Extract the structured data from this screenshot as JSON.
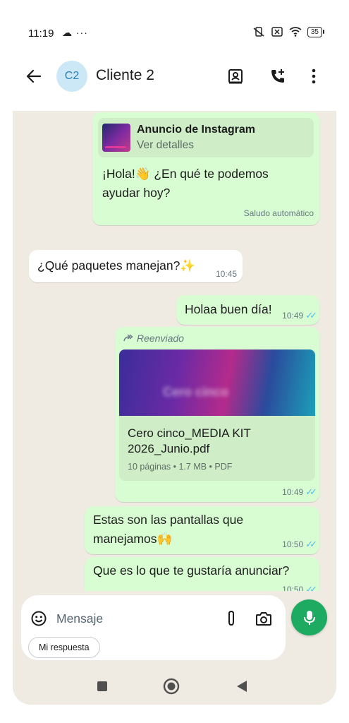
{
  "status_bar": {
    "time": "11:19",
    "left_icons": "☁ ···",
    "battery": "35"
  },
  "header": {
    "avatar_initials": "C2",
    "contact_name": "Cliente 2"
  },
  "messages": {
    "auto_greeting": {
      "ad_title": "Anuncio de Instagram",
      "ad_link": "Ver detalles",
      "text": "¡Hola!👋 ¿En qué te podemos ayudar hoy?",
      "footer": "Saludo automático"
    },
    "incoming_question": {
      "text": "¿Qué paquetes manejan?✨",
      "time": "10:45"
    },
    "reply_hello": {
      "text": "Holaa buen día!",
      "time": "10:49"
    },
    "forwarded_doc": {
      "forwarded_label": "Reenviado",
      "preview_text": "Cero cinco",
      "file_name": "Cero cinco_MEDIA KIT 2026_Junio.pdf",
      "file_details": "10 páginas • 1.7 MB • PDF",
      "time": "10:49"
    },
    "screens_msg": {
      "text": "Estas son las pantallas que manejamos🙌",
      "time": "10:50"
    },
    "ask_msg": {
      "text": "Que es lo que te gustaría anunciar?",
      "time": "10:50"
    }
  },
  "composer": {
    "placeholder": "Mensaje",
    "quick_reply_chip": "Mi respuesta"
  },
  "colors": {
    "outgoing_bubble": "#d9fdd3",
    "incoming_bubble": "#ffffff",
    "chat_background": "#efeae2",
    "read_ticks": "#53bdeb",
    "mic_button": "#1daa61",
    "avatar_bg": "#cce8f6"
  }
}
